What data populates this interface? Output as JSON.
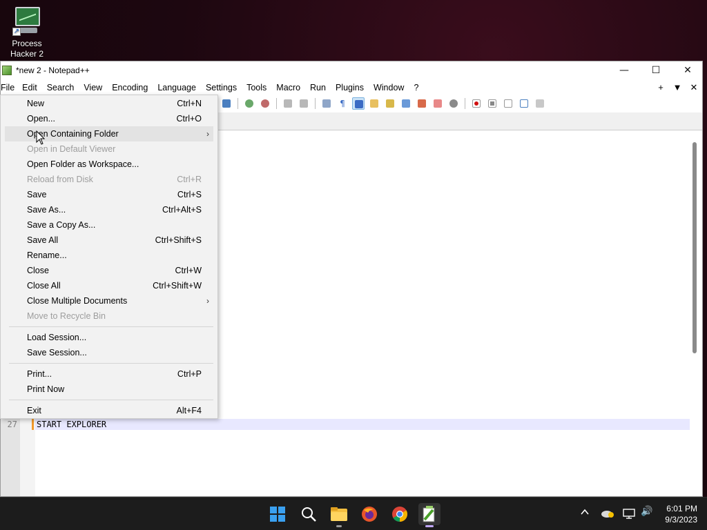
{
  "desktop": {
    "icons": [
      {
        "label_line1": "Process",
        "label_line2": "Hacker 2",
        "icon": "process-hacker-icon"
      }
    ]
  },
  "window": {
    "title": "*new 2 - Notepad++",
    "controls": {
      "minimize": "—",
      "maximize": "☐",
      "close": "✕"
    }
  },
  "menubar": {
    "items": [
      "File",
      "Edit",
      "Search",
      "View",
      "Encoding",
      "Language",
      "Settings",
      "Tools",
      "Macro",
      "Run",
      "Plugins",
      "Window",
      "?"
    ],
    "right": [
      "+",
      "▼",
      "✕"
    ]
  },
  "file_menu": {
    "items": [
      {
        "label": "New",
        "shortcut": "Ctrl+N"
      },
      {
        "label": "Open...",
        "shortcut": "Ctrl+O"
      },
      {
        "label": "Open Containing Folder",
        "submenu": true,
        "hovered": true
      },
      {
        "label": "Open in Default Viewer",
        "disabled": true
      },
      {
        "label": "Open Folder as Workspace..."
      },
      {
        "label": "Reload from Disk",
        "shortcut": "Ctrl+R",
        "disabled": true
      },
      {
        "label": "Save",
        "shortcut": "Ctrl+S"
      },
      {
        "label": "Save As...",
        "shortcut": "Ctrl+Alt+S"
      },
      {
        "label": "Save a Copy As..."
      },
      {
        "label": "Save All",
        "shortcut": "Ctrl+Shift+S"
      },
      {
        "label": "Rename..."
      },
      {
        "label": "Close",
        "shortcut": "Ctrl+W"
      },
      {
        "label": "Close All",
        "shortcut": "Ctrl+Shift+W"
      },
      {
        "label": "Close Multiple Documents",
        "submenu": true
      },
      {
        "label": "Move to Recycle Bin",
        "disabled": true
      },
      {
        "label": "Load Session..."
      },
      {
        "label": "Save Session..."
      },
      {
        "label": "Print...",
        "shortcut": "Ctrl+P"
      },
      {
        "label": "Print Now"
      },
      {
        "label": "Exit",
        "shortcut": "Alt+F4"
      }
    ]
  },
  "editor": {
    "line_number": "27",
    "line_text": "START EXPLORER"
  },
  "taskbar": {
    "apps": [
      "start-icon",
      "search-icon",
      "file-explorer-icon",
      "firefox-icon",
      "chrome-icon",
      "notepad-plus-plus-icon"
    ],
    "tray": {
      "chevron": "^",
      "volume": "🔊"
    },
    "clock_time": "6:01 PM",
    "clock_date": "9/3/2023"
  }
}
